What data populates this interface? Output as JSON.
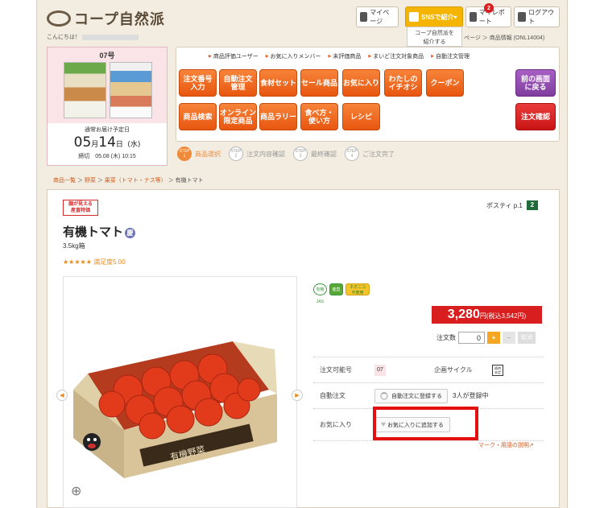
{
  "brand": {
    "logo_text": "コープ自然派"
  },
  "header": {
    "mypage": "マイページ",
    "sns": "SNSで紹介▾",
    "myreport": "マイレポート",
    "myreport_badge": "2",
    "logout": "ログアウト",
    "sns_popup_line1": "コープ自然派を",
    "sns_popup_line2": "紹介する",
    "greeting": "こんにちは！",
    "breadcrumb_right": "ページ ＞ 商品情報 (ONL14004)"
  },
  "delivery": {
    "issue": "07号",
    "due_label": "通常お届け予定日",
    "month": "05",
    "month_unit": "月",
    "day": "14",
    "day_unit": "日",
    "weekday": "(水)",
    "deadline": "締切　05.08 (木) 10:15"
  },
  "menu": {
    "links": [
      "商品評価ユーザー",
      "お気に入りメンバー",
      "未評価商品",
      "まいど注文対象商品",
      "自動注文管理"
    ],
    "row1": [
      "注文番号\n入力",
      "自動注文\n管理",
      "食材セット",
      "セール商品",
      "お気に入り",
      "わたしの\nイチオシ",
      "クーポン"
    ],
    "row2": [
      "商品検索",
      "オンライン\n限定商品",
      "商品ラリー",
      "食べ方・\n使い方",
      "レシピ"
    ],
    "back": "前の画面\nに戻る",
    "confirm": "注文確認"
  },
  "steps": [
    {
      "num": "STEP\n1",
      "label": "商品選択"
    },
    {
      "num": "STEP\n2",
      "label": "注文内容確認"
    },
    {
      "num": "STEP\n3",
      "label": "最終確認"
    },
    {
      "num": "STEP\n4",
      "label": "ご注文完了"
    }
  ],
  "breadcrumb": {
    "items": [
      "商品一覧",
      "野菜",
      "果菜（トマト・ナス等）"
    ],
    "current": "有機トマト"
  },
  "product": {
    "tag": "顔が見える\n産直特価",
    "name": "有機トマト",
    "kei": "慶",
    "size": "3.5kg箱",
    "stars": "★★★★★",
    "rating": "満足度5.00",
    "posty_label": "ポスティ p.1",
    "posty_num": "2",
    "box_text": "有機野菜",
    "certs": [
      "有機JAS",
      "産直",
      "ネオニコ\n不使用"
    ],
    "price": "3,280",
    "price_unit": "円",
    "price_tax": "(税込3,542円)",
    "qty_label": "注文数",
    "qty_value": "0",
    "plus": "+",
    "minus": "−",
    "cancel": "取消",
    "order_no_label": "注文可能号",
    "order_no": "07",
    "cycle_label": "企画サイクル",
    "cycle_icon_text": "随時\n未定",
    "auto_label": "自動注文",
    "auto_btn": "自動注文に登録する",
    "auto_count": "3人が登録中",
    "fav_label": "お気に入り",
    "fav_btn": "お気に入りに追加する",
    "mark_link": "マーク・用語の説明"
  },
  "colors": {
    "accent_orange": "#e8560f",
    "price_red": "#d81e1e",
    "bg": "#f3ede1"
  }
}
